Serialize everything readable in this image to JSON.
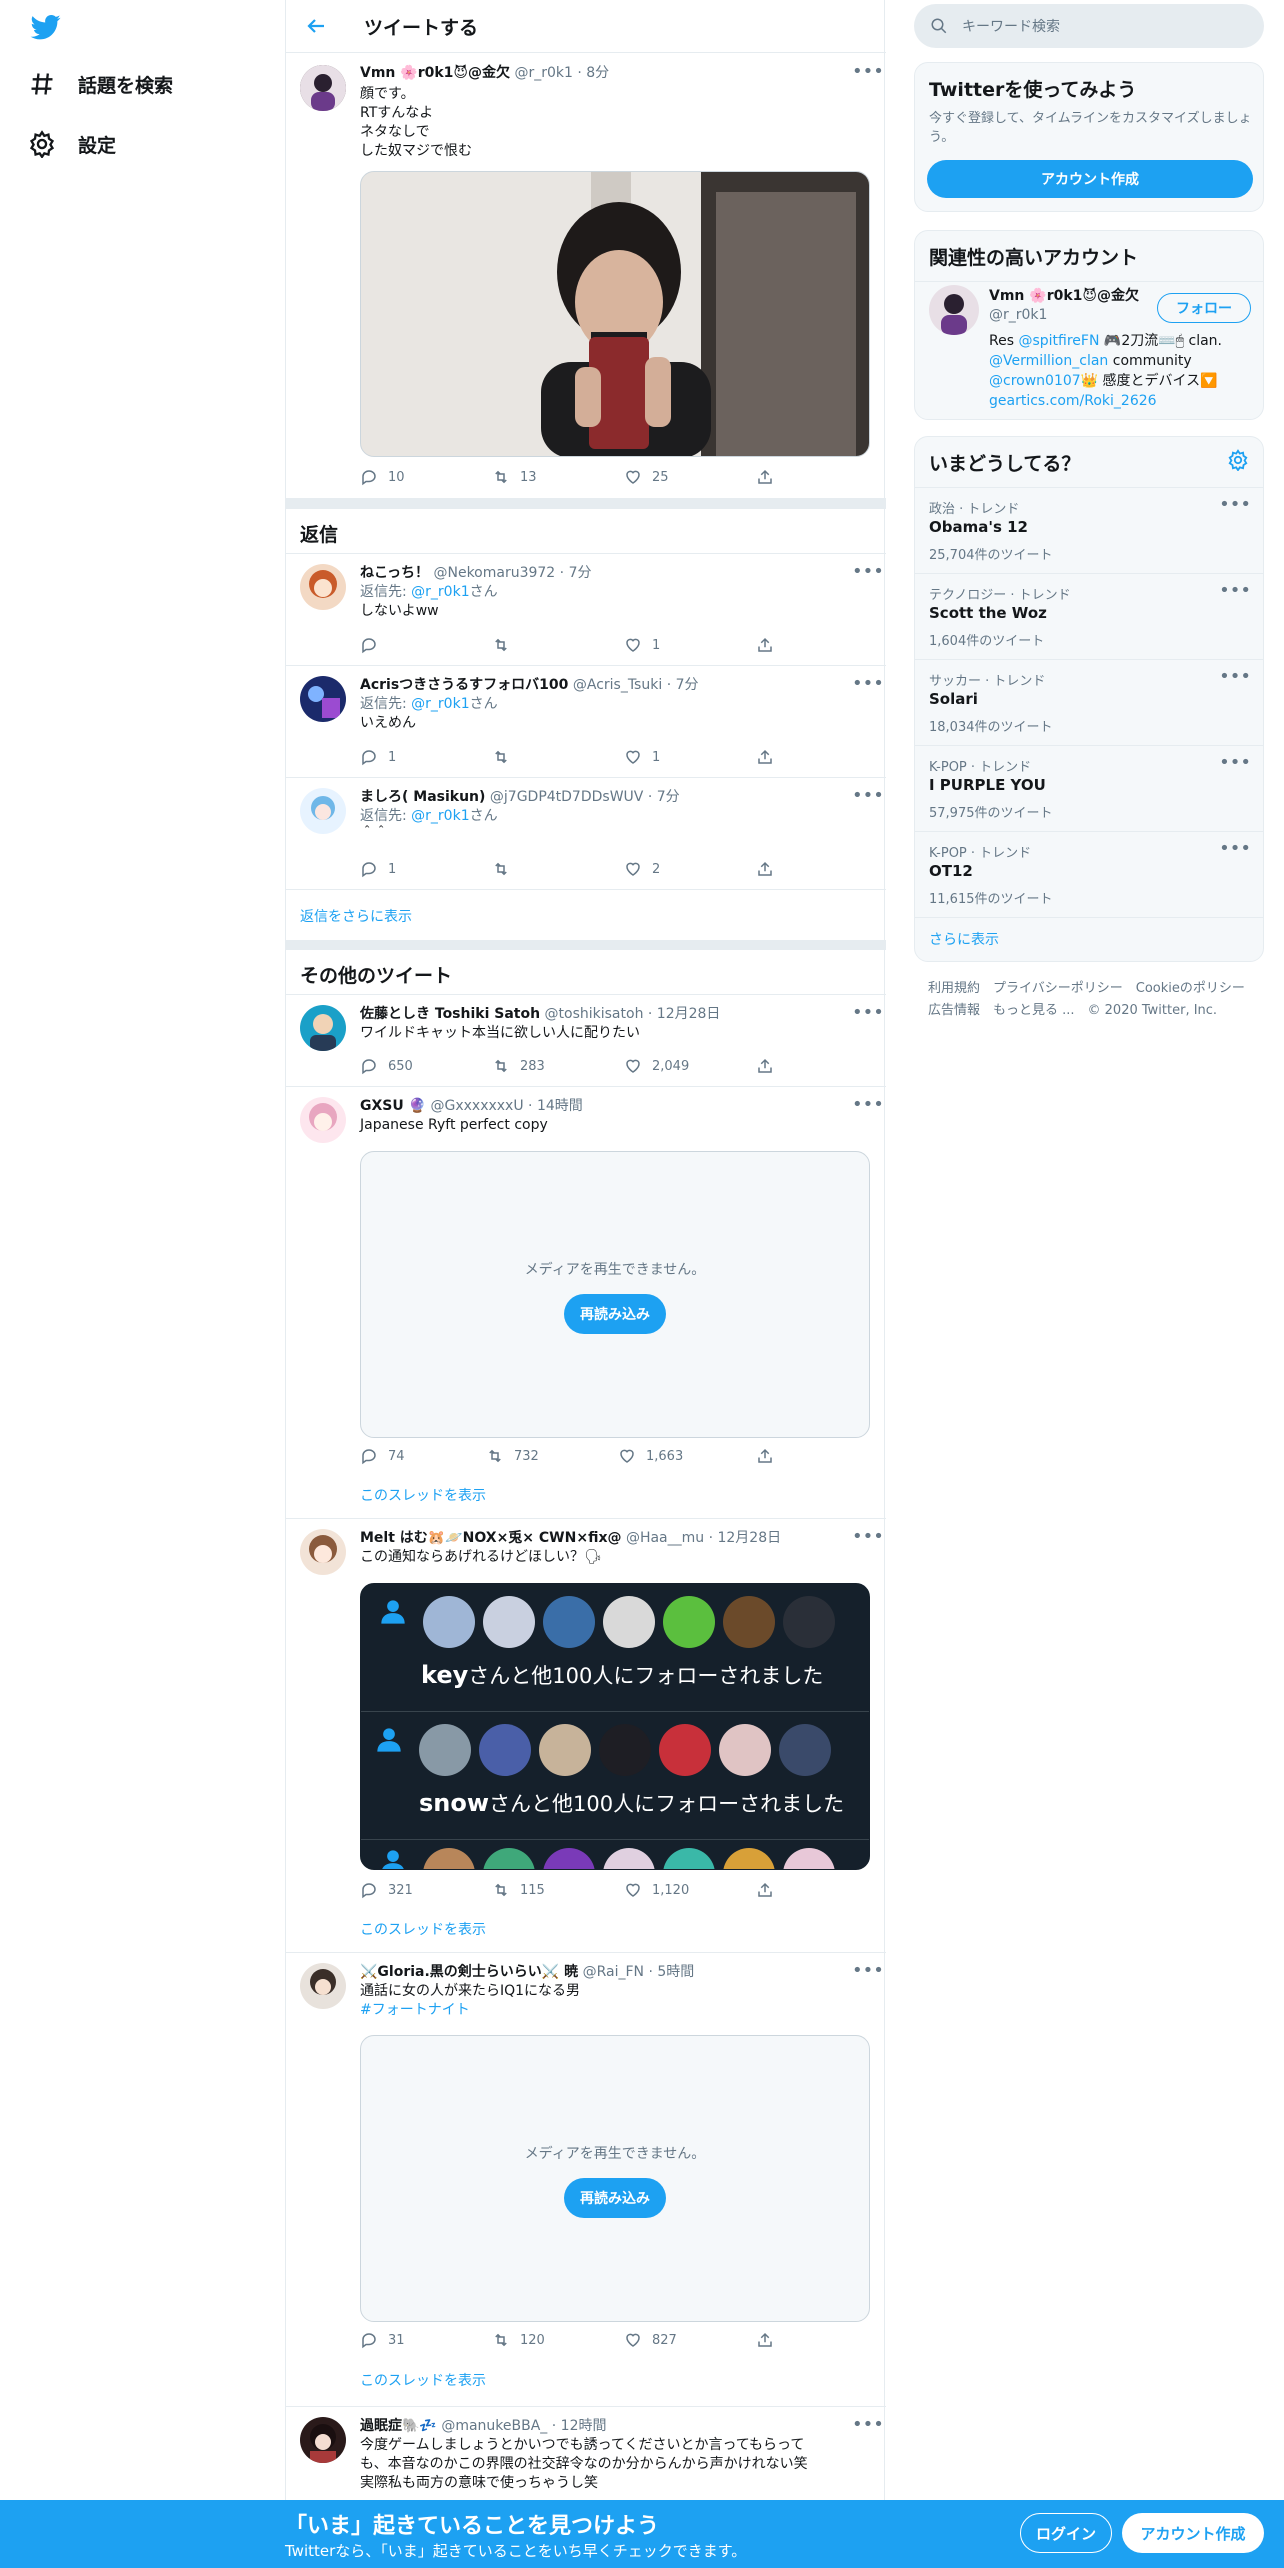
{
  "nav": {
    "explore_label": "話題を検索",
    "settings_label": "設定"
  },
  "header": {
    "title": "ツイートする"
  },
  "main_tweet": {
    "name": "Vmn 🌸r0k1😈@金欠",
    "handle": "@r_r0k1",
    "time": "· 8分",
    "lines": [
      "顔です。",
      "RTすんなよ",
      "ネタなしで",
      "した奴マジで恨む"
    ],
    "replies": "10",
    "retweets": "13",
    "likes": "25"
  },
  "replies_section": {
    "title": "返信"
  },
  "replies": [
    {
      "name": "ねこっち！",
      "handle": "@Nekomaru3972",
      "time": "· 7分",
      "reply_prefix": "返信先: ",
      "reply_to": "@r_r0k1",
      "reply_suffix": "さん",
      "text": "しないよww",
      "replies": "",
      "retweets": "",
      "likes": "1"
    },
    {
      "name": "Acrisつきさうるすフォロバ100",
      "handle": "@Acris_Tsuki",
      "time": "· 7分",
      "reply_prefix": "返信先: ",
      "reply_to": "@r_r0k1",
      "reply_suffix": "さん",
      "text": "いえめん",
      "replies": "1",
      "retweets": "",
      "likes": "1"
    },
    {
      "name": "ましろ( Masikun)",
      "handle": "@j7GDP4tD7DDsWUV",
      "time": "· 7分",
      "reply_prefix": "返信先: ",
      "reply_to": "@r_r0k1",
      "reply_suffix": "さん",
      "text": "＾＾",
      "replies": "1",
      "retweets": "",
      "likes": "2"
    }
  ],
  "show_more_replies": "返信をさらに表示",
  "other_section": {
    "title": "その他のツイート"
  },
  "other": [
    {
      "name": "佐藤としき Toshiki Satoh",
      "handle": "@toshikisatoh",
      "time": "· 12月28日",
      "text": "ワイルドキャット本当に欲しい人に配りたい",
      "replies": "650",
      "retweets": "283",
      "likes": "2,049"
    },
    {
      "name": "GXSU 🔮",
      "handle": "@GxxxxxxxU",
      "time": "· 14時間",
      "text": "Japanese Ryft perfect copy",
      "media_msg": "メディアを再生できません。",
      "reload": "再読み込み",
      "replies": "74",
      "retweets": "732",
      "likes": "1,663",
      "thread": "このスレッドを表示"
    },
    {
      "name": "Melt はむ🐹🪐NOX×兎× CWN×fix@",
      "handle": "@Haa__mu",
      "time": "· 12月28日",
      "text": "この通知ならあげれるけどほしい？🗣",
      "notif1_name": "key",
      "notif2_name": "snow",
      "notif_suffix": "さんと他100人にフォローされました",
      "replies": "321",
      "retweets": "115",
      "likes": "1,120",
      "thread": "このスレッドを表示"
    },
    {
      "name": "⚔️Gloria.黒の剣士らいらい⚔️ 暁",
      "handle": "@Rai_FN",
      "time": "· 5時間",
      "text": "通話に女の人が来たらIQ1になる男",
      "hashtag": "#フォートナイト",
      "media_msg": "メディアを再生できません。",
      "reload": "再読み込み",
      "replies": "31",
      "retweets": "120",
      "likes": "827",
      "thread": "このスレッドを表示"
    },
    {
      "name": "過眠症🐘💤",
      "handle": "@manukeBBA_",
      "time": "· 12時間",
      "lines": [
        "今度ゲームしましょうとかいつでも誘ってくださいとか言ってもらって",
        "も、本音なのかこの界隈の社交辞令なのか分からんから声かけれない笑",
        "実際私も両方の意味で使っちゃうし笑"
      ]
    }
  ],
  "search": {
    "placeholder": "キーワード検索"
  },
  "signup_card": {
    "title": "Twitterを使ってみよう",
    "desc1": "今すぐ登録して、タイムラインをカスタマイズしましょ",
    "desc2": "う。",
    "button": "アカウント作成"
  },
  "related_card": {
    "title": "関連性の高いアカウント",
    "name": "Vmn 🌸r0k1😈@金欠",
    "handle": "@r_r0k1",
    "follow": "フォロー",
    "bio1_a": "Res ",
    "bio1_link": "@spitfireFN",
    "bio1_b": " 🎮2刀流⌨️🖱 clan.",
    "bio2_link": "@Vermillion_clan",
    "bio2_b": " community",
    "bio3_link": "@crown0107",
    "bio3_b": "👑 感度とデバイス🔽",
    "bio4_link": "geartics.com/Roki_2626"
  },
  "trends_card": {
    "title": "いまどうしてる？",
    "items": [
      {
        "cat": "政治 · トレンド",
        "name": "Obama's 12",
        "count": "25,704件のツイート"
      },
      {
        "cat": "テクノロジー · トレンド",
        "name": "Scott the Woz",
        "count": "1,604件のツイート"
      },
      {
        "cat": "サッカー · トレンド",
        "name": "Solari",
        "count": "18,034件のツイート"
      },
      {
        "cat": "K-POP · トレンド",
        "name": "I PURPLE YOU",
        "count": "57,975件のツイート"
      },
      {
        "cat": "K-POP · トレンド",
        "name": "OT12",
        "count": "11,615件のツイート"
      }
    ],
    "show_more": "さらに表示"
  },
  "footer": {
    "line1": "利用規約　プライバシーポリシー　Cookieのポリシー",
    "line2": "広告情報　もっと見る ...　© 2020 Twitter, Inc."
  },
  "bottom_bar": {
    "title": "「いま」起きていることを見つけよう",
    "subtitle": "Twitterなら、「いま」起きていることをいち早くチェックできます。",
    "login": "ログイン",
    "signup": "アカウント作成"
  },
  "colors": {
    "accent": "#1da1f2",
    "border": "#e6ecf0",
    "muted": "#657786"
  }
}
